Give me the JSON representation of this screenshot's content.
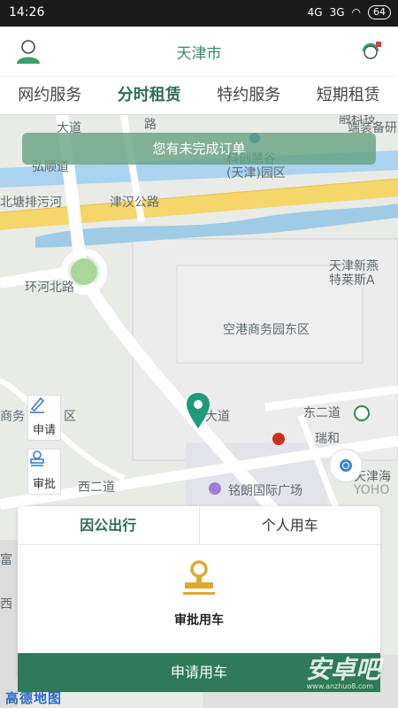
{
  "status": {
    "time": "14:26",
    "net1": "4G",
    "net2": "3G",
    "battery": "64"
  },
  "header": {
    "title": "天津市"
  },
  "tabs": [
    {
      "label": "网约服务"
    },
    {
      "label": "分时租赁",
      "active": true
    },
    {
      "label": "特约服务"
    },
    {
      "label": "短期租赁"
    }
  ],
  "notice": "您有未完成订单",
  "map": {
    "labels": {
      "dadao_top": "大道",
      "lu": "路",
      "keji": "融科技",
      "duanbei": "端装备研",
      "hongshun": "弘顺道",
      "kechuang": "科创慧谷(天津)园区",
      "beitang": "北塘排污河",
      "jinhan": "津汉公路",
      "huanhe": "环河北路",
      "xinyan": "天津新燕",
      "telaisi": "特莱斯A",
      "kongang": "空港商务园东区",
      "shangwu": "商务",
      "qu": "区",
      "dadao_mid": "大道",
      "dong2": "东二道",
      "rui": "瑞和",
      "xi2": "西二道",
      "minglang": "铭朗国际广场",
      "tianjin_hai": "天津海",
      "yoho": "YOHO",
      "fu": "富",
      "xi": "西"
    }
  },
  "side": {
    "apply_label": "申请",
    "approve_label": "审批"
  },
  "panel": {
    "tabs": [
      {
        "label": "因公出行",
        "active": true
      },
      {
        "label": "个人用车"
      }
    ],
    "approval_label": "审批用车",
    "apply_button": "申请用车"
  },
  "footer": {
    "map_logo": "高德地图",
    "watermark": "安卓吧",
    "watermark_sub": "www.anzhuo8.com"
  },
  "colors": {
    "accent": "#2f7a58",
    "notice_bg": "#63a080",
    "pin": "#1e9a7a",
    "highlight": "#f5d66b"
  }
}
